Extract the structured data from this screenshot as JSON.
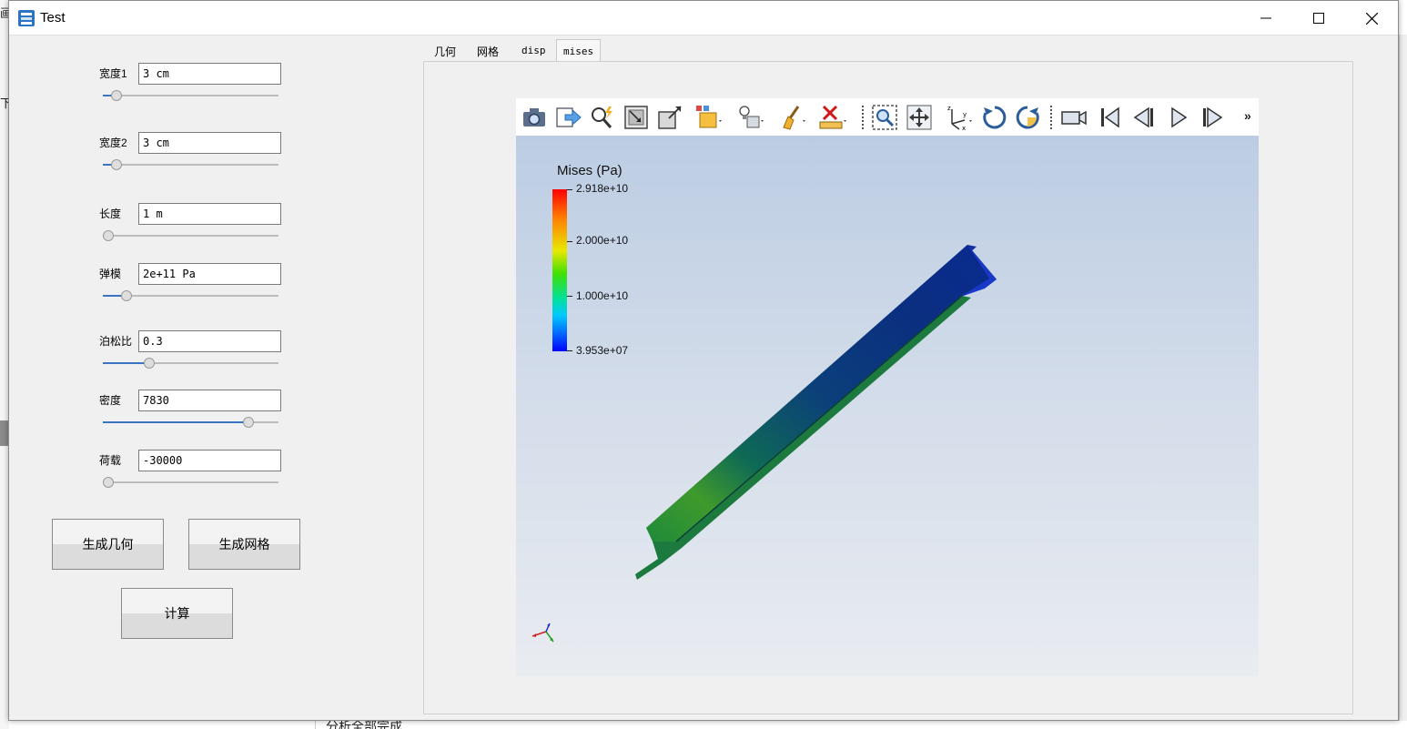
{
  "window": {
    "title": "Test"
  },
  "background": {
    "left_text_1": "画",
    "left_text_2": "下",
    "bottom_text": "分析全部完成."
  },
  "params": [
    {
      "label": "宽度1",
      "value": "3 cm",
      "slider_fraction": 0.05
    },
    {
      "label": "宽度2",
      "value": "3 cm",
      "slider_fraction": 0.05
    },
    {
      "label": "长度",
      "value": "1 m",
      "slider_fraction": 0.0
    },
    {
      "label": "弹模",
      "value": "2e+11 Pa",
      "slider_fraction": 0.11
    },
    {
      "label": "泊松比",
      "value": "0.3",
      "slider_fraction": 0.25
    },
    {
      "label": "密度",
      "value": "7830",
      "slider_fraction": 0.85
    },
    {
      "label": "荷载",
      "value": "-30000",
      "slider_fraction": 0.0
    }
  ],
  "buttons": {
    "geometry": "生成几何",
    "mesh": "生成网格",
    "compute": "计算"
  },
  "tabs": [
    {
      "label": "几何",
      "active": false
    },
    {
      "label": "网格",
      "active": false
    },
    {
      "label": "disp",
      "active": false
    },
    {
      "label": "mises",
      "active": true
    }
  ],
  "toolbar": {
    "icons": [
      "camera-icon",
      "export-icon",
      "magic-zoom-icon",
      "reset-view-icon",
      "maximize-icon",
      "representation-icon",
      "light-icon",
      "clear-icon",
      "ruler-delete-icon",
      "zoom-box-icon",
      "pan-icon",
      "axes-icon",
      "rotate-cw-icon",
      "rotate-ccw-icon",
      "camera-video-icon",
      "first-frame-icon",
      "prev-frame-icon",
      "play-icon",
      "next-frame-icon"
    ],
    "more": "»"
  },
  "colorbar": {
    "title": "Mises (Pa)",
    "labels": [
      "2.918e+10",
      "2.000e+10",
      "1.000e+10",
      "3.953e+07"
    ]
  },
  "colors": {
    "accent": "#3b74c0",
    "render_top": "#bccde3",
    "render_bottom": "#e9ecf1"
  }
}
